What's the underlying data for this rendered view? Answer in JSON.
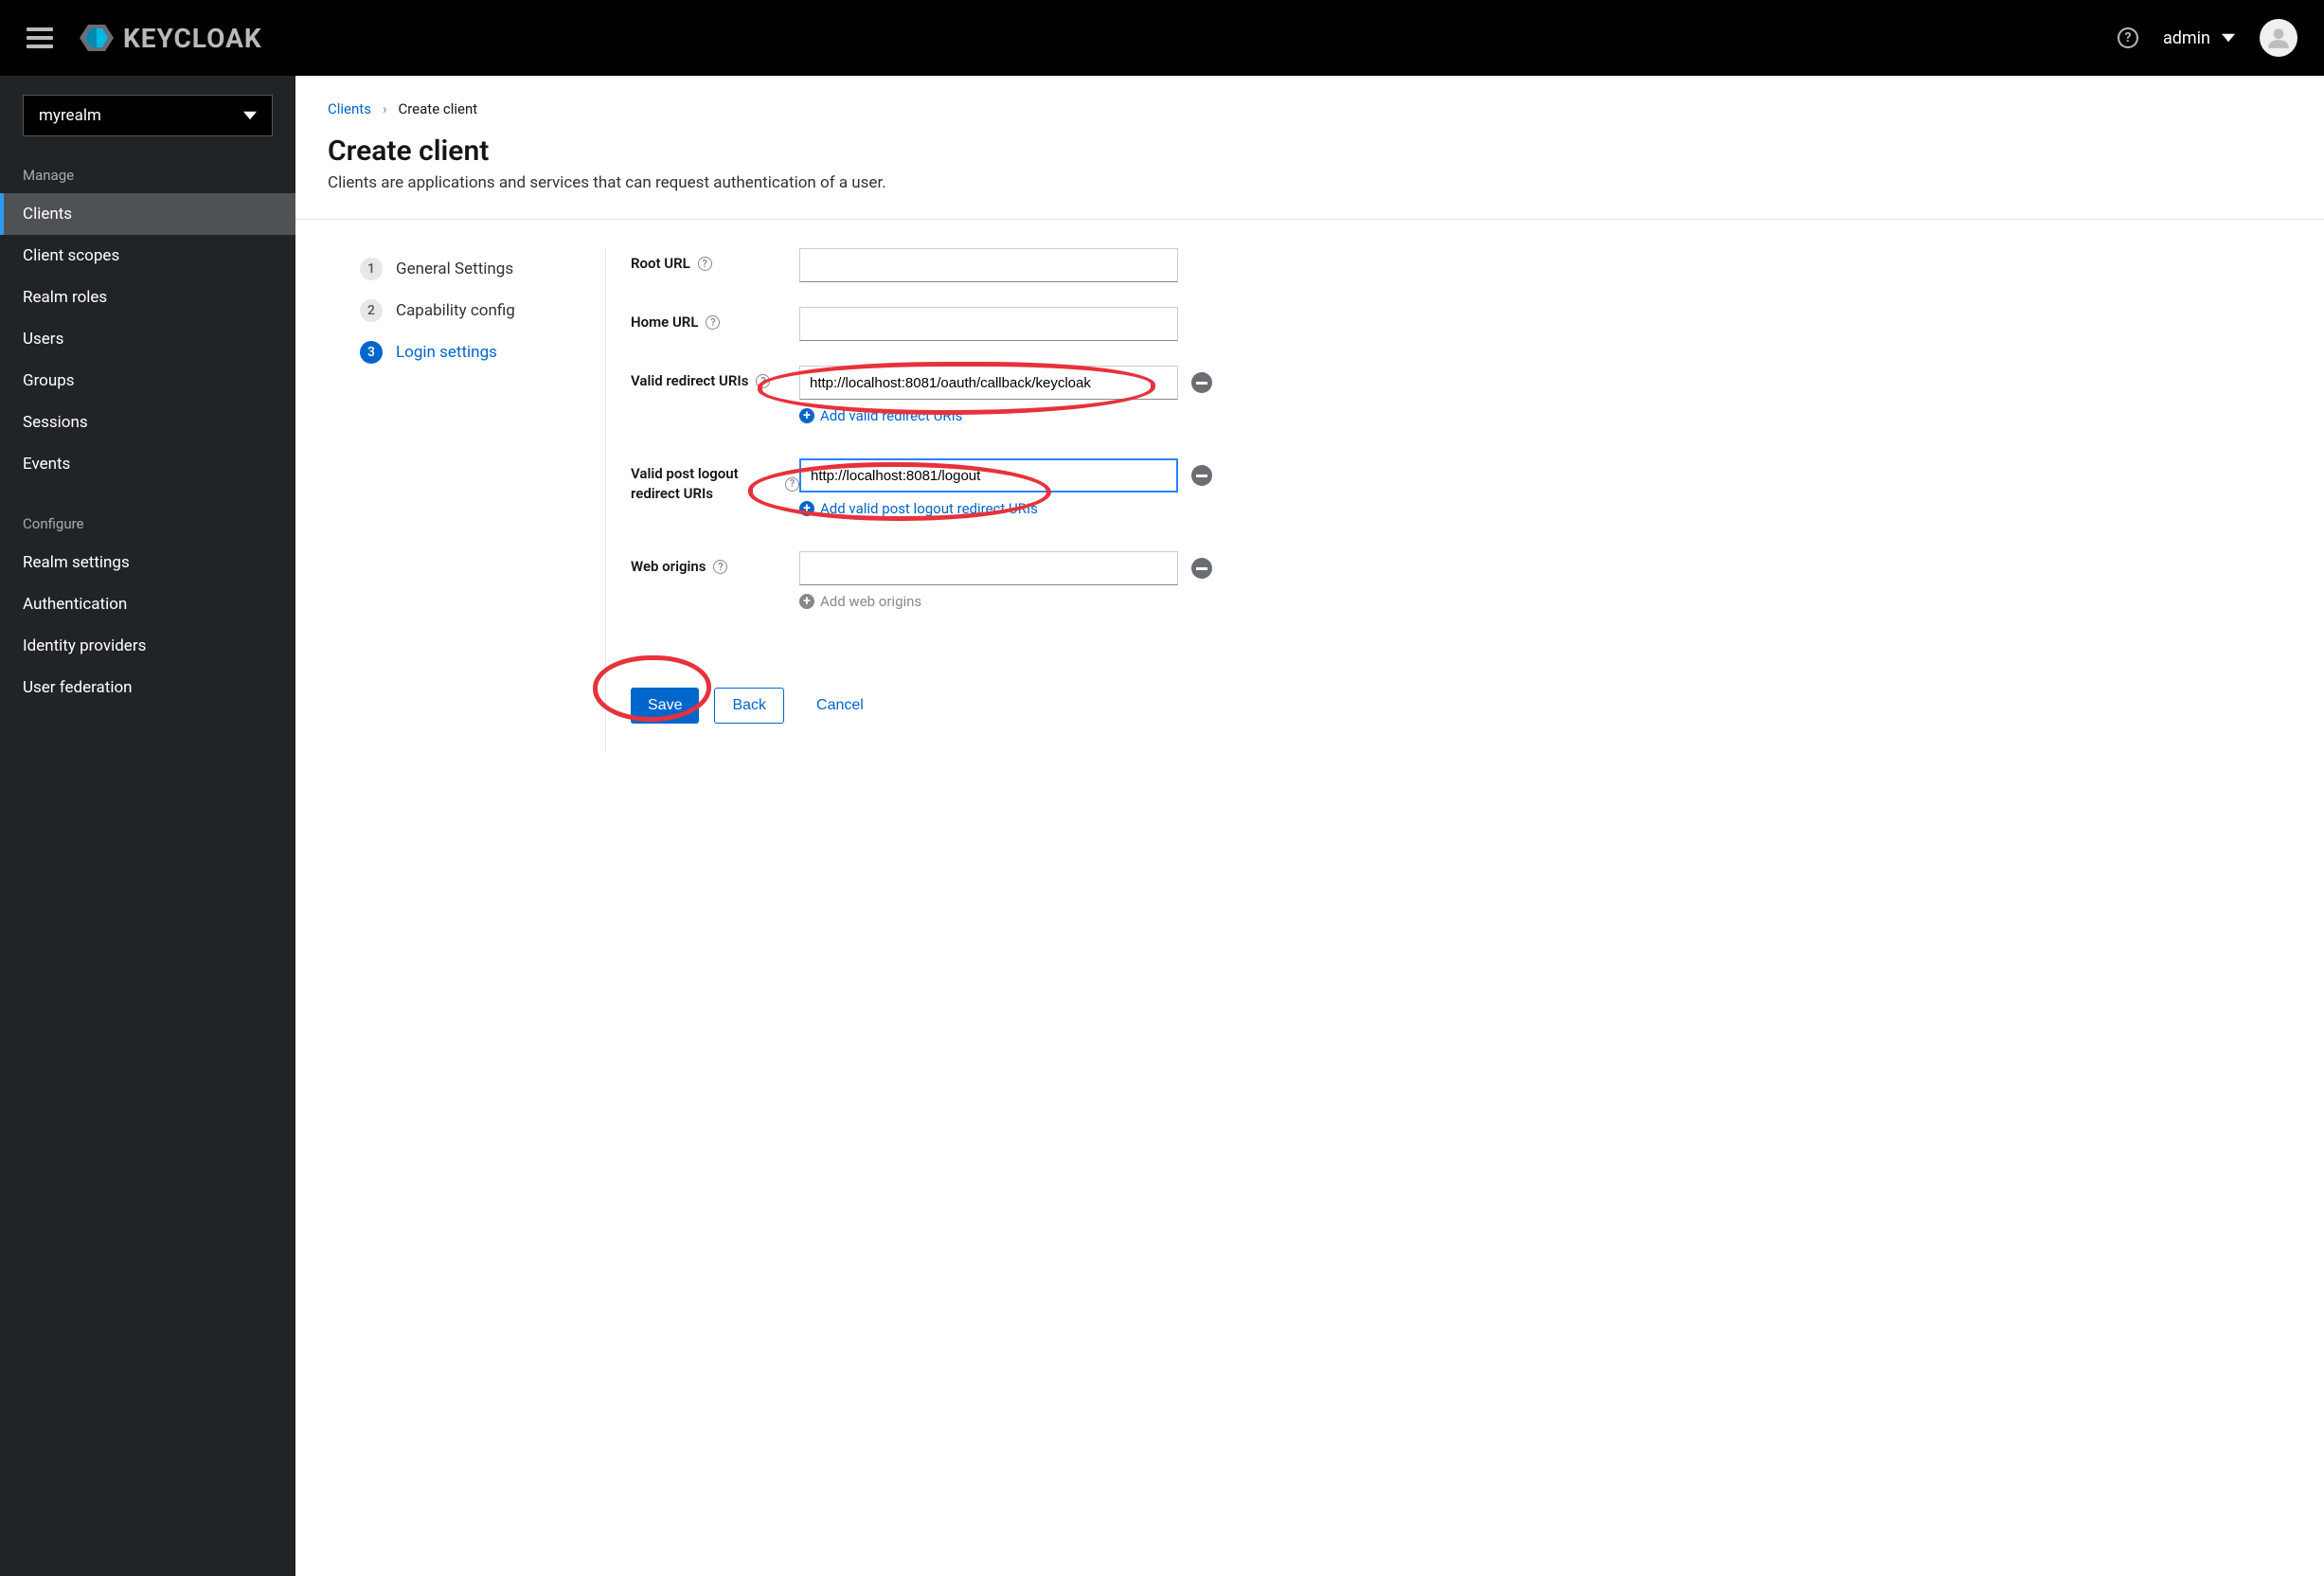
{
  "header": {
    "brand": "KEYCLOAK",
    "username": "admin"
  },
  "sidebar": {
    "realm": "myrealm",
    "section_manage": "Manage",
    "section_configure": "Configure",
    "manage_items": [
      {
        "label": "Clients",
        "active": true
      },
      {
        "label": "Client scopes"
      },
      {
        "label": "Realm roles"
      },
      {
        "label": "Users"
      },
      {
        "label": "Groups"
      },
      {
        "label": "Sessions"
      },
      {
        "label": "Events"
      }
    ],
    "configure_items": [
      {
        "label": "Realm settings"
      },
      {
        "label": "Authentication"
      },
      {
        "label": "Identity providers"
      },
      {
        "label": "User federation"
      }
    ]
  },
  "breadcrumb": {
    "parent": "Clients",
    "current": "Create client"
  },
  "page": {
    "title": "Create client",
    "description": "Clients are applications and services that can request authentication of a user."
  },
  "steps": [
    {
      "num": "1",
      "label": "General Settings"
    },
    {
      "num": "2",
      "label": "Capability config"
    },
    {
      "num": "3",
      "label": "Login settings",
      "active": true
    }
  ],
  "form": {
    "root_url": {
      "label": "Root URL",
      "value": ""
    },
    "home_url": {
      "label": "Home URL",
      "value": ""
    },
    "redirect_uris": {
      "label": "Valid redirect URIs",
      "value": "http://localhost:8081/oauth/callback/keycloak",
      "add_label": "Add valid redirect URIs"
    },
    "logout_uris": {
      "label": "Valid post logout redirect URIs",
      "value": "http://localhost:8081/logout",
      "add_label": "Add valid post logout redirect URIs"
    },
    "web_origins": {
      "label": "Web origins",
      "value": "",
      "add_label": "Add web origins"
    }
  },
  "footer": {
    "save": "Save",
    "back": "Back",
    "cancel": "Cancel"
  }
}
